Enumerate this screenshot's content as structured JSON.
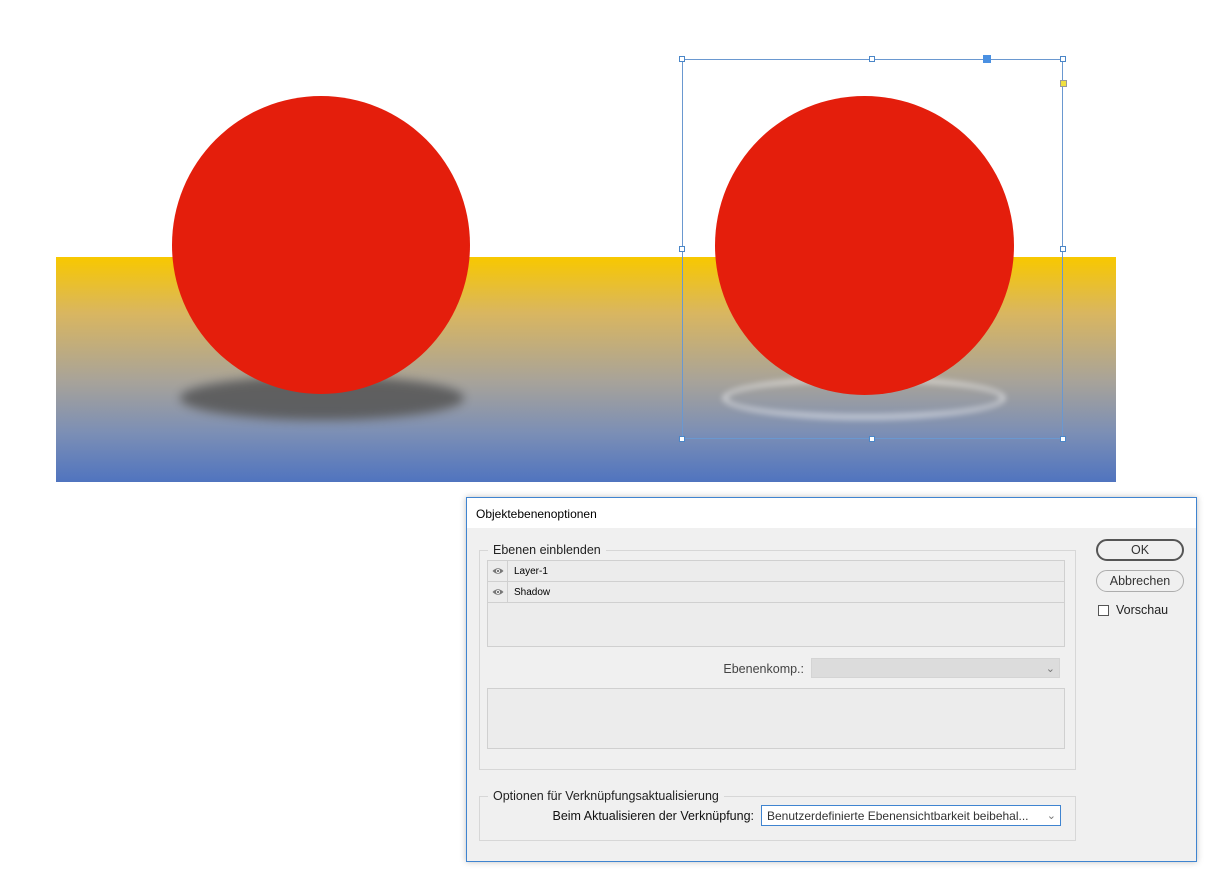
{
  "dialog": {
    "title": "Objektebenenoptionen",
    "layers_group_label": "Ebenen einblenden",
    "layers": [
      {
        "name": "Layer-1",
        "visible": true
      },
      {
        "name": "Shadow",
        "visible": true
      }
    ],
    "layer_comp_label": "Ebenenkomp.:",
    "layer_comp_value": "",
    "link_group_label": "Optionen für Verknüpfungsaktualisierung",
    "link_update_label": "Beim Aktualisieren der Verknüpfung:",
    "link_update_value": "Benutzerdefinierte Ebenensichtbarkeit beibehal...",
    "ok_label": "OK",
    "cancel_label": "Abbrechen",
    "preview_label": "Vorschau",
    "preview_checked": false
  },
  "colors": {
    "ball": "#e41e0c",
    "band_top": "#f8c800",
    "band_bottom": "#5074bf",
    "selection": "#4a86c8",
    "dialog_border": "#3f84d0"
  },
  "icons": {
    "layer_visibility": "eye-icon",
    "dropdown": "chevron-down-icon"
  }
}
